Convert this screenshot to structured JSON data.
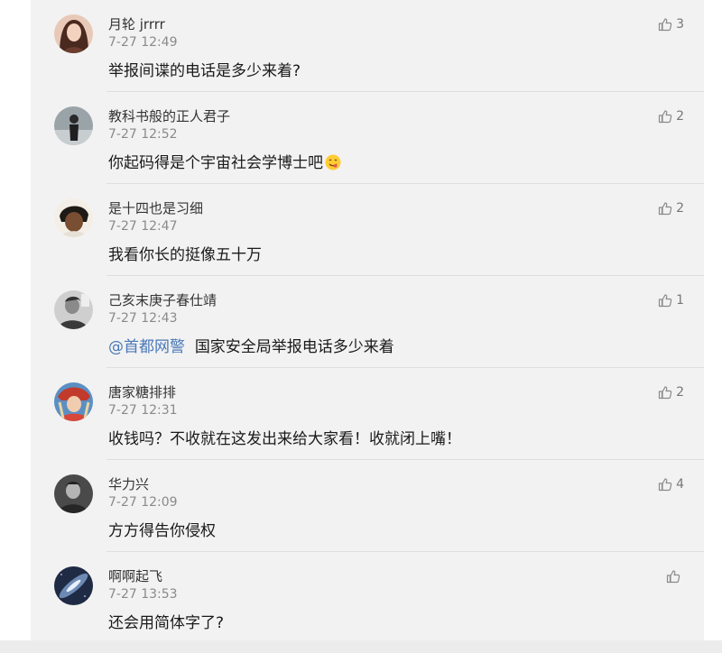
{
  "comments": [
    {
      "username": "月轮 jrrrr",
      "time": "7-27 12:49",
      "text": "举报间谍的电话是多少来着?",
      "likes": "3",
      "avatar_icon": "woman-portrait-avatar"
    },
    {
      "username": "教科书般的正人君子",
      "time": "7-27 12:52",
      "text": "你起码得是个宇宙社会学博士吧",
      "emoji": "yum-emoji-icon",
      "likes": "2",
      "avatar_icon": "silhouette-avatar"
    },
    {
      "username": "是十四也是习细",
      "time": "7-27 12:47",
      "text": "我看你长的挺像五十万",
      "likes": "2",
      "avatar_icon": "cartoon-character-avatar"
    },
    {
      "username": "己亥末庚子春仕靖",
      "time": "7-27 12:43",
      "mention": "@首都网警",
      "text": "国家安全局举报电话多少来着",
      "likes": "1",
      "avatar_icon": "bw-portrait-avatar"
    },
    {
      "username": "唐家糖排排",
      "time": "7-27 12:31",
      "text": "收钱吗？不收就在这发出来给大家看！收就闭上嘴！",
      "likes": "2",
      "avatar_icon": "colorful-character-avatar"
    },
    {
      "username": "华力兴",
      "time": "7-27 12:09",
      "text": "方方得告你侵权",
      "likes": "4",
      "avatar_icon": "man-portrait-avatar"
    },
    {
      "username": "啊啊起飞",
      "time": "7-27 13:53",
      "text": "还会用简体字了?",
      "likes": "",
      "avatar_icon": "galaxy-avatar"
    }
  ],
  "colors": {
    "panel_bg": "#f2f2f2",
    "mention": "#4a78b8",
    "meta_text": "#8a8a8a"
  }
}
